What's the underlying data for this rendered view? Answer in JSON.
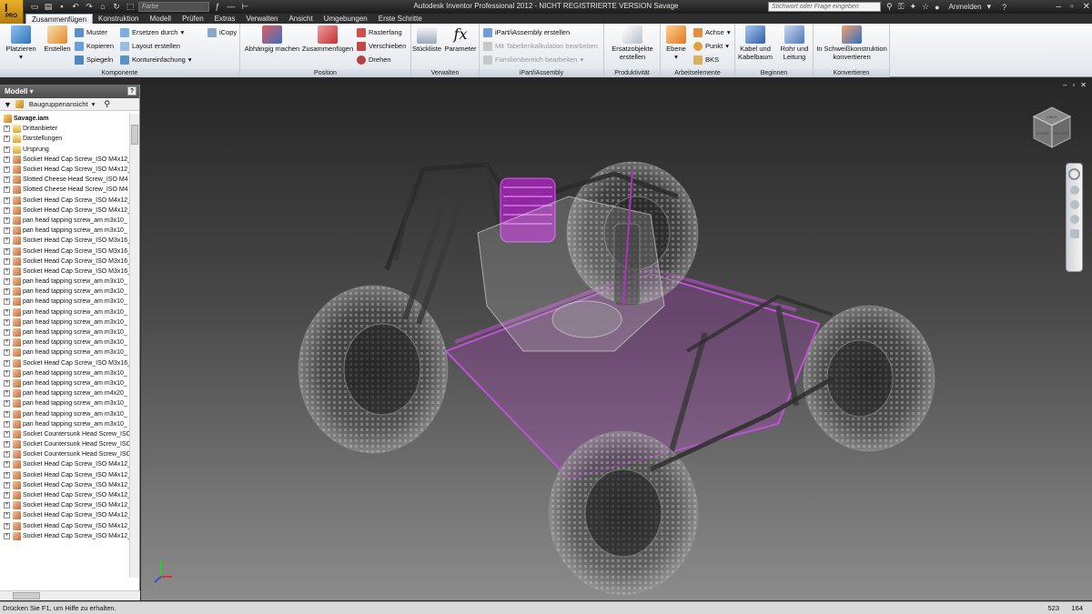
{
  "app": {
    "logo_text": "PRO",
    "logo_letter": "I",
    "title": "Autodesk Inventor Professional 2012 - NICHT REGISTRIERTE VERSION   Savage",
    "color_combo": "Farbe",
    "search_placeholder": "Stichwort oder Frage eingeben",
    "login": "Anmelden"
  },
  "ribbon_tabs": [
    "Zusammenfügen",
    "Konstruktion",
    "Modell",
    "Prüfen",
    "Extras",
    "Verwalten",
    "Ansicht",
    "Umgebungen",
    "Erste Schritte"
  ],
  "panels": {
    "komponente": {
      "title": "Komponente",
      "platzieren": "Platzieren",
      "erstellen": "Erstellen",
      "muster": "Muster",
      "kopieren": "Kopieren",
      "spiegeln": "Spiegeln",
      "ersetzen": "Ersetzen durch",
      "layout": "Layout erstellen",
      "kontur": "Kontureinfachung",
      "icopy": "iCopy"
    },
    "position": {
      "title": "Position",
      "abhaengig": "Abhängig machen",
      "zusammenfuegen": "Zusammenfügen",
      "rasterfang": "Rasterfang",
      "verschieben": "Verschieben",
      "drehen": "Drehen"
    },
    "verwalten": {
      "title": "Verwalten",
      "stueckliste": "Stückliste",
      "parameter": "Parameter"
    },
    "ipart": {
      "title": "iPart/iAssembly",
      "erstellen": "iPart/iAssembly erstellen",
      "tabelle": "Mit Tabellenkalkulation bearbeiten",
      "familie": "Familienbereich bearbeiten"
    },
    "produktivitaet": {
      "title": "Produktivität",
      "ersatz_line1": "Ersatzobjekte",
      "ersatz_line2": "erstellen"
    },
    "arbeitselemente": {
      "title": "Arbeitselemente",
      "ebene": "Ebene",
      "achse": "Achse",
      "punkt": "Punkt",
      "bks": "BKS"
    },
    "beginnen": {
      "title": "Beginnen",
      "kabel_line1": "Kabel und",
      "kabel_line2": "Kabelbaum",
      "rohr_line1": "Rohr und",
      "rohr_line2": "Leitung"
    },
    "konvertieren": {
      "title": "Konvertieren",
      "schweiss_line1": "In Schweißkonstruktion",
      "schweiss_line2": "konvertieren"
    }
  },
  "browser": {
    "title": "Modell",
    "view_mode": "Baugruppenansicht",
    "items": [
      {
        "label": "Savage.iam",
        "type": "asm",
        "root": true
      },
      {
        "label": "Drittanbieter",
        "type": "folder"
      },
      {
        "label": "Darstellungen",
        "type": "folder"
      },
      {
        "label": "Ursprung",
        "type": "folder"
      },
      {
        "label": "Socket Head Cap Screw_ISO M4x12_",
        "type": "part"
      },
      {
        "label": "Socket Head Cap Screw_ISO M4x12_",
        "type": "part"
      },
      {
        "label": "Slotted Cheese Head Screw_ISO M4",
        "type": "part"
      },
      {
        "label": "Slotted Cheese Head Screw_ISO M4",
        "type": "part"
      },
      {
        "label": "Socket Head Cap Screw_ISO M4x12_",
        "type": "part"
      },
      {
        "label": "Socket Head Cap Screw_ISO M4x12_",
        "type": "part"
      },
      {
        "label": "pan head tapping screw_am m3x10_",
        "type": "part"
      },
      {
        "label": "pan head tapping screw_am m3x10_",
        "type": "part"
      },
      {
        "label": "Socket Head Cap Screw_ISO M3x16_",
        "type": "part"
      },
      {
        "label": "Socket Head Cap Screw_ISO M3x16_",
        "type": "part"
      },
      {
        "label": "Socket Head Cap Screw_ISO M3x16_",
        "type": "part"
      },
      {
        "label": "Socket Head Cap Screw_ISO M3x16_",
        "type": "part"
      },
      {
        "label": "pan head tapping screw_am m3x10_",
        "type": "part"
      },
      {
        "label": "pan head tapping screw_am m3x10_",
        "type": "part"
      },
      {
        "label": "pan head tapping screw_am m3x10_",
        "type": "part"
      },
      {
        "label": "pan head tapping screw_am m3x10_",
        "type": "part"
      },
      {
        "label": "pan head tapping screw_am m3x10_",
        "type": "part"
      },
      {
        "label": "pan head tapping screw_am m3x10_",
        "type": "part"
      },
      {
        "label": "pan head tapping screw_am m3x10_",
        "type": "part"
      },
      {
        "label": "pan head tapping screw_am m3x10_",
        "type": "part"
      },
      {
        "label": "Socket Head Cap Screw_ISO M3x16_",
        "type": "part"
      },
      {
        "label": "pan head tapping screw_am m3x10_",
        "type": "part"
      },
      {
        "label": "pan head tapping screw_am m3x10_",
        "type": "part"
      },
      {
        "label": "pan head tapping screw_am m4x20_",
        "type": "part"
      },
      {
        "label": "pan head tapping screw_am m3x10_",
        "type": "part"
      },
      {
        "label": "pan head tapping screw_am m3x10_",
        "type": "part"
      },
      {
        "label": "pan head tapping screw_am m3x10_",
        "type": "part"
      },
      {
        "label": "Socket Countersunk Head Screw_ISC",
        "type": "part"
      },
      {
        "label": "Socket Countersunk Head Screw_ISC",
        "type": "part"
      },
      {
        "label": "Socket Countersunk Head Screw_ISC",
        "type": "part"
      },
      {
        "label": "Socket Head Cap Screw_ISO M4x12_",
        "type": "part"
      },
      {
        "label": "Socket Head Cap Screw_ISO M4x12_",
        "type": "part"
      },
      {
        "label": "Socket Head Cap Screw_ISO M4x12_",
        "type": "part"
      },
      {
        "label": "Socket Head Cap Screw_ISO M4x12_",
        "type": "part"
      },
      {
        "label": "Socket Head Cap Screw_ISO M4x12_",
        "type": "part"
      },
      {
        "label": "Socket Head Cap Screw_ISO M4x12_",
        "type": "part"
      },
      {
        "label": "Socket Head Cap Screw_ISO M4x12_",
        "type": "part"
      },
      {
        "label": "Socket Head Cap Screw_ISO M4x12_",
        "type": "part"
      }
    ]
  },
  "viewcube_labels": {
    "top": "OBEN",
    "front": "VORNE",
    "right": "RECHTS"
  },
  "status": {
    "help_text": "Drücken Sie F1, um Hilfe zu erhalten.",
    "coord_x": "523",
    "coord_y": "164"
  },
  "colors": {
    "accent_highlight": "#b026c8",
    "ribbon_bg": "#f0f2f5",
    "title_bg": "#2a2a2a"
  }
}
